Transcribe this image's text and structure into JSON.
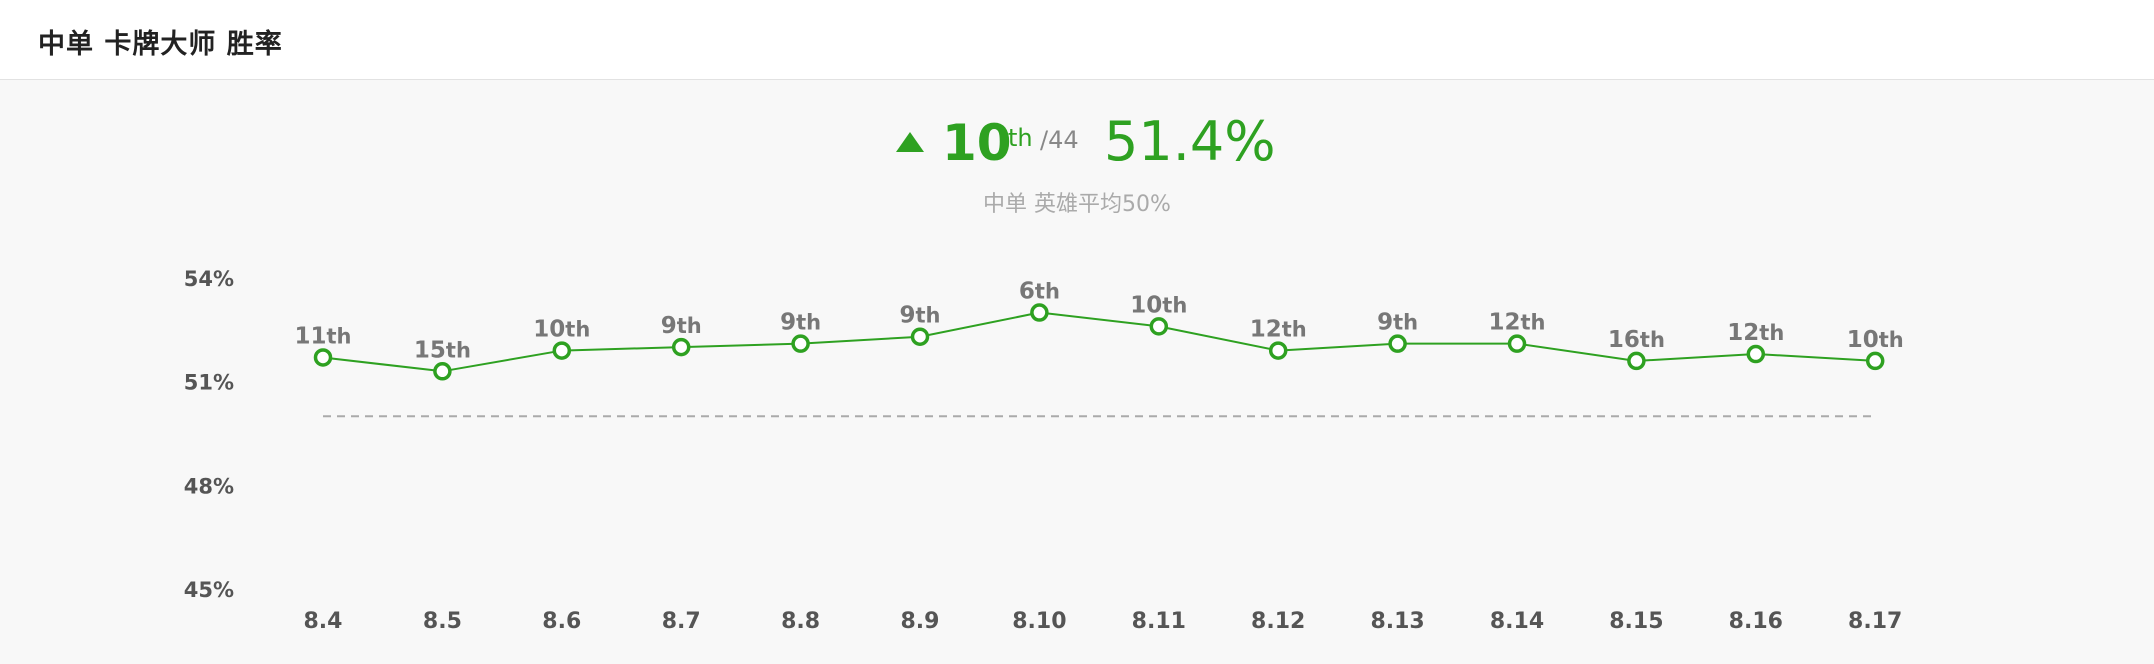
{
  "header": {
    "title": "中单 卡牌大师 胜率"
  },
  "summary": {
    "rank": "10",
    "rank_suffix": "th",
    "rank_total": "/44",
    "win_rate": "51.4%",
    "subtitle": "中单 英雄平均50%"
  },
  "colors": {
    "accent": "#2ea121",
    "reference_line": "#aaaaaa"
  },
  "chart_data": {
    "type": "line",
    "categories": [
      "8.4",
      "8.5",
      "8.6",
      "8.7",
      "8.8",
      "8.9",
      "8.10",
      "8.11",
      "8.12",
      "8.13",
      "8.14",
      "8.15",
      "8.16",
      "8.17"
    ],
    "series": [
      {
        "values": [
          51.7,
          51.3,
          51.9,
          52.0,
          52.1,
          52.3,
          53.0,
          52.6,
          51.9,
          52.1,
          52.1,
          51.6,
          51.8,
          51.6
        ],
        "ranks": [
          "11",
          "15",
          "10",
          "9",
          "9",
          "9",
          "6",
          "10",
          "12",
          "9",
          "12",
          "16",
          "12",
          "10"
        ],
        "rank_suffix": "th"
      }
    ],
    "reference_value": 50,
    "ylim": [
      45,
      54
    ],
    "yticks": [
      54,
      51,
      48,
      45
    ],
    "ytick_labels": [
      "54%",
      "51%",
      "48%",
      "45%"
    ],
    "grid": false
  }
}
